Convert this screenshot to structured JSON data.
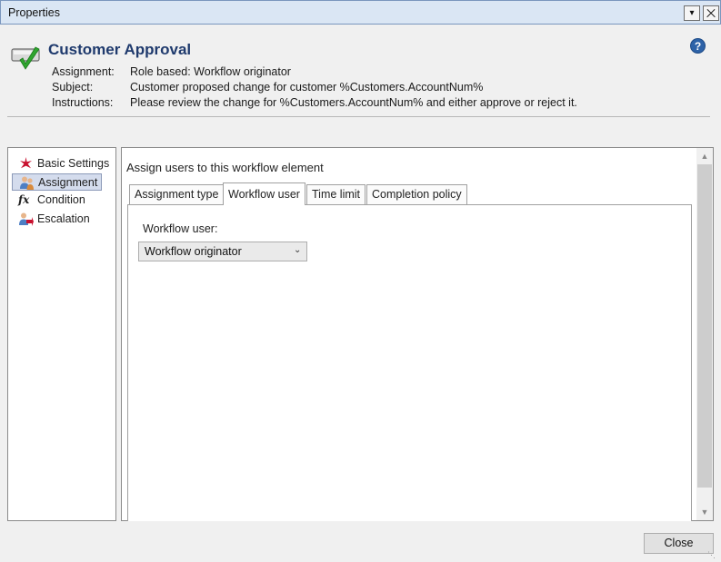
{
  "window": {
    "title": "Properties",
    "pin_glyph": "▾",
    "close_glyph": ""
  },
  "header": {
    "title": "Customer Approval",
    "help_glyph": "?",
    "rows": [
      {
        "label": "Assignment:",
        "value": "Role based: Workflow originator"
      },
      {
        "label": "Subject:",
        "value": "Customer proposed change for customer  %Customers.AccountNum%"
      },
      {
        "label": "Instructions:",
        "value": "Please review the change for %Customers.AccountNum% and either approve or reject it."
      }
    ]
  },
  "nav": {
    "items": [
      {
        "label": "Basic Settings",
        "icon": "star-icon"
      },
      {
        "label": "Assignment",
        "icon": "users-icon",
        "selected": true
      },
      {
        "label": "Condition",
        "icon": "fx-icon"
      },
      {
        "label": "Escalation",
        "icon": "escalation-icon"
      }
    ]
  },
  "main": {
    "section_title": "Assign users to this workflow element",
    "tabs": [
      {
        "label": "Assignment type"
      },
      {
        "label": "Workflow user",
        "active": true
      },
      {
        "label": "Time limit"
      },
      {
        "label": "Completion policy"
      }
    ],
    "workflow_user_label": "Workflow user:",
    "workflow_user_value": "Workflow originator"
  },
  "footer": {
    "close_label": "Close"
  },
  "colors": {
    "title_blue": "#1f3a6d",
    "selection": "#d4dced",
    "check_green": "#2fa52f",
    "star_red": "#c8102e"
  }
}
